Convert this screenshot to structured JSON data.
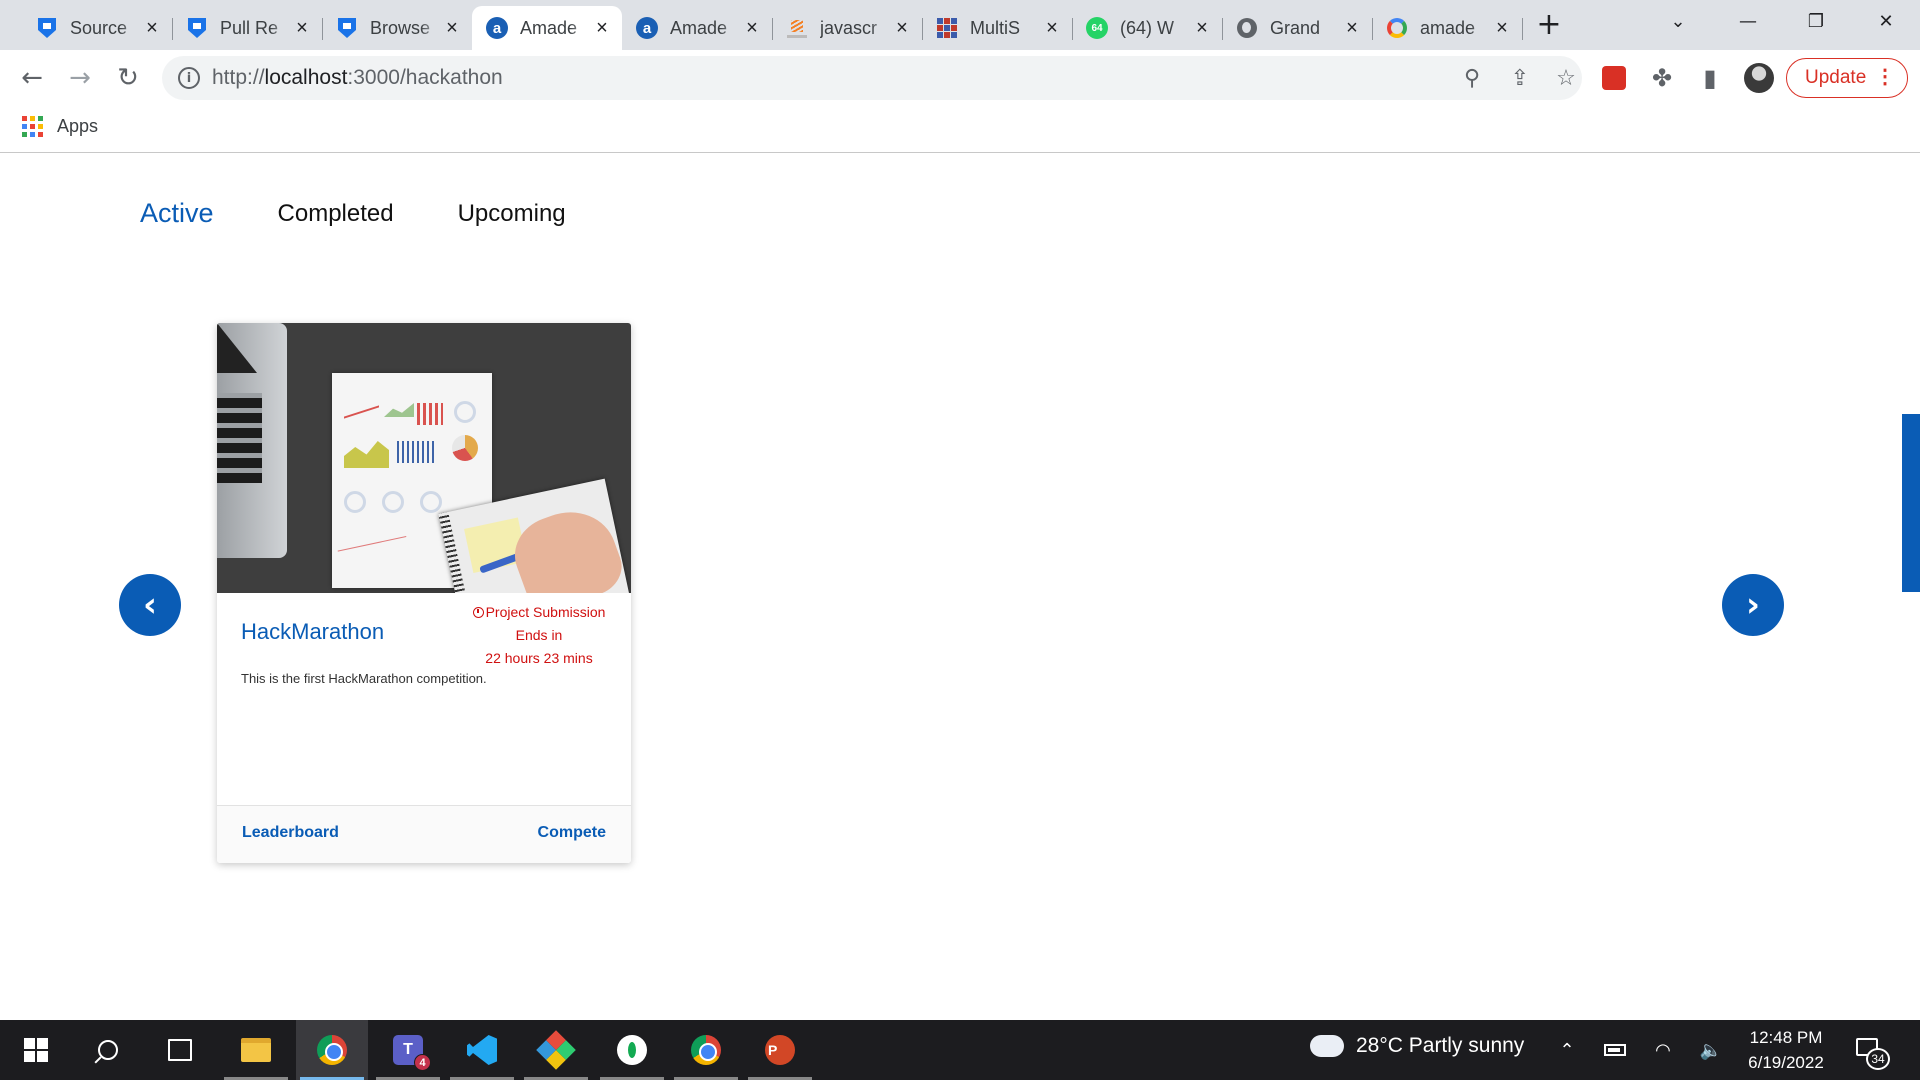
{
  "browser": {
    "tabs": [
      {
        "title": "Source",
        "favicon": "shield-icon"
      },
      {
        "title": "Pull Re",
        "favicon": "shield-icon"
      },
      {
        "title": "Browse",
        "favicon": "shield-icon"
      },
      {
        "title": "Amade",
        "favicon": "amadeus-icon",
        "active": true
      },
      {
        "title": "Amade",
        "favicon": "amadeus-icon"
      },
      {
        "title": "javascr",
        "favicon": "stackoverflow-icon"
      },
      {
        "title": "MultiS",
        "favicon": "multisite-icon"
      },
      {
        "title": "(64) W",
        "favicon": "whatsapp-icon",
        "badge": "64"
      },
      {
        "title": "Grand",
        "favicon": "globe-icon"
      },
      {
        "title": "amade",
        "favicon": "google-icon"
      }
    ],
    "url_scheme": "http://",
    "url_host": "localhost",
    "url_path": ":3000/hackathon",
    "update_label": "Update",
    "bookmarks": {
      "apps_label": "Apps"
    }
  },
  "page": {
    "tabs": [
      {
        "label": "Active",
        "active": true
      },
      {
        "label": "Completed"
      },
      {
        "label": "Upcoming"
      }
    ],
    "prev_glyph": "‹",
    "next_glyph": "›",
    "card": {
      "title": "HackMarathon",
      "deadline_line1": "Project Submission",
      "deadline_line2": "Ends in",
      "deadline_line3": "22 hours 23 mins",
      "description": "This is the first HackMarathon competition.",
      "leaderboard_label": "Leaderboard",
      "compete_label": "Compete"
    }
  },
  "taskbar": {
    "teams_badge": "4",
    "ppt_letter": "P",
    "teams_letter": "T",
    "weather": "28°C  Partly sunny",
    "time": "12:48 PM",
    "date": "6/19/2022",
    "notifications": "34"
  },
  "colors": {
    "accent": "#0a5cb5",
    "deadline": "#d01010",
    "update": "#d93025"
  }
}
